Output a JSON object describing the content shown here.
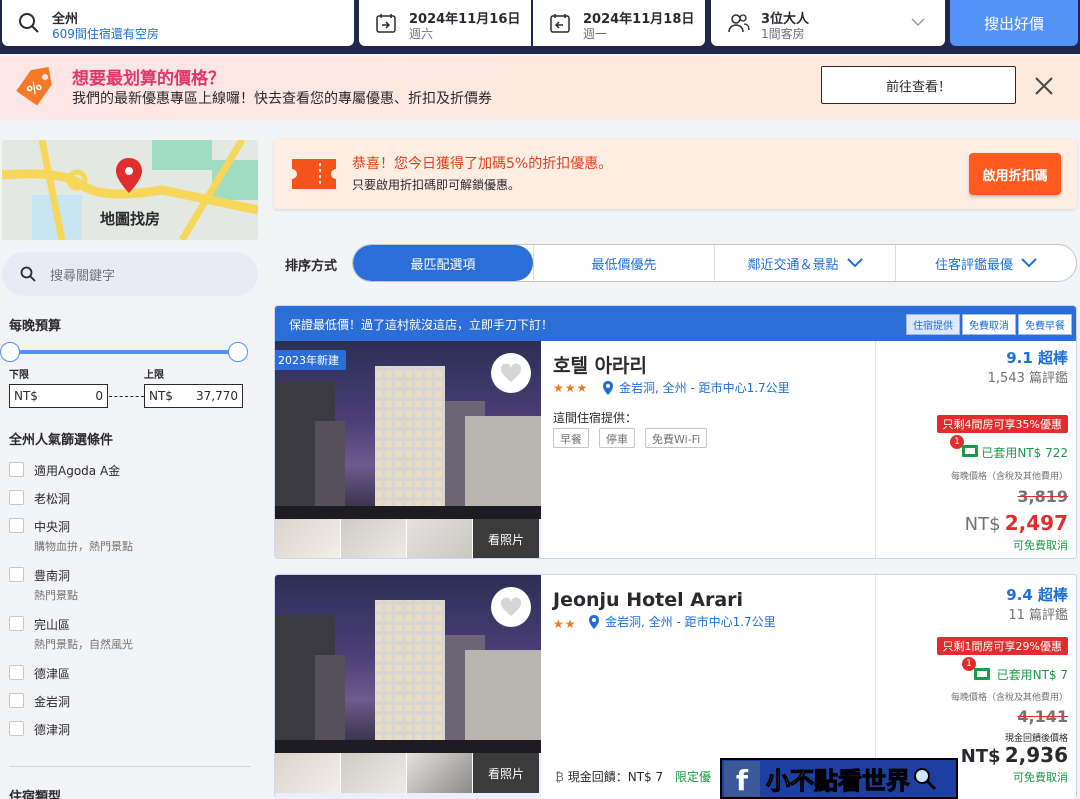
{
  "search": {
    "destination": "全州",
    "availability": "609間住宿還有空房",
    "checkin_date": "2024年11月16日",
    "checkin_day": "週六",
    "checkout_date": "2024年11月18日",
    "checkout_day": "週一",
    "guests": "3位大人",
    "rooms": "1間客房",
    "submit": "搜出好價"
  },
  "promo": {
    "title": "想要最划算的價格？",
    "text": "我們的最新優惠專區上線囉！快去查看您的專屬優惠、折扣及折價券",
    "button": "前往查看！"
  },
  "sidebar": {
    "map_label": "地圖找房",
    "search_placeholder": "搜尋關鍵字",
    "budget_heading": "每晚預算",
    "min_label": "下限",
    "max_label": "上限",
    "currency": "NT$",
    "min_value": "0",
    "max_value": "37,770",
    "budget_min_fraction": 0.0,
    "budget_max_fraction": 1.0,
    "filters_heading": "全州人氣篩選條件",
    "filters": [
      {
        "label": "適用Agoda A金",
        "sub": ""
      },
      {
        "label": "老松洞",
        "sub": ""
      },
      {
        "label": "中央洞",
        "sub": "購物血拚，熱門景點"
      },
      {
        "label": "豊南洞",
        "sub": "熱門景點"
      },
      {
        "label": "完山區",
        "sub": "熱門景點，自然風光"
      },
      {
        "label": "德津區",
        "sub": ""
      },
      {
        "label": "金岩洞",
        "sub": ""
      },
      {
        "label": "德津洞",
        "sub": ""
      }
    ],
    "type_heading": "住宿類型"
  },
  "coupon": {
    "title": "恭喜！您今日獲得了加碼5%的折扣優惠。",
    "subtitle": "只要啟用折扣碼即可解鎖優惠。",
    "button": "啟用折扣碼"
  },
  "sort": {
    "label": "排序方式",
    "options": [
      "最匹配選項",
      "最低價優先",
      "鄰近交通＆景點",
      "住客評鑑最優"
    ]
  },
  "listings": [
    {
      "banner": "保證最低價！過了這村就沒這店，立即手刀下訂！",
      "banner_tags": [
        "住宿提供",
        "免費取消",
        "免費早餐"
      ],
      "new_badge": "2023年新建",
      "name": "호텔 아라리",
      "stars": "★★★",
      "location": "金岩洞, 全州 - 距市中心1.7公里",
      "offers_label": "這間住宿提供：",
      "amenities": [
        "早餐",
        "停車",
        "免費Wi-Fi"
      ],
      "rating": "9.1 超棒",
      "reviews": "1,543 篇評鑑",
      "deal": "只剩4間房可享35%優惠",
      "applied_badge": "1",
      "applied": "已套用NT$ 722",
      "per_night": "每晚價格（含稅及其他費用）",
      "original_price": "3,819",
      "currency": "NT$",
      "final_price": "2,497",
      "free_cancel": "可免費取消",
      "photo_button": "看照片"
    },
    {
      "name": "Jeonju Hotel Arari",
      "stars": "★★",
      "location": "金岩洞, 全州 - 距市中心1.7公里",
      "rating": "9.4 超棒",
      "reviews": "11 篇評鑑",
      "deal": "只剩1間房可享29%優惠",
      "applied_badge": "1",
      "applied": "已套用NT$ 7",
      "per_night": "每晚價格（含稅及其他費用）",
      "original_price": "4,141",
      "cash_label": "現金回饋後價格",
      "currency": "NT$",
      "final_price": "2,936",
      "free_cancel": "可免費取消",
      "cashback": "現金回饋：NT$ 7",
      "limited": "限定優",
      "photo_button": "看照片"
    }
  ],
  "watermark": {
    "fb": "f",
    "text": "小不點看世界"
  }
}
